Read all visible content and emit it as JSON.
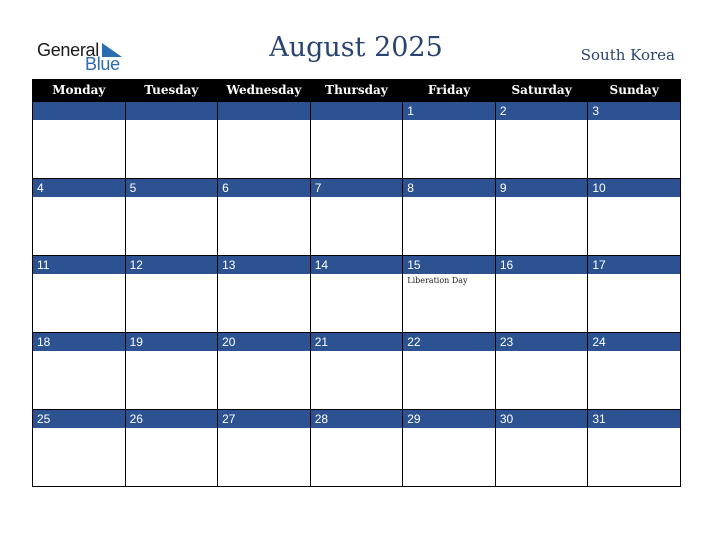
{
  "logo": {
    "word1": "General",
    "word2": "Blue"
  },
  "title": "August 2025",
  "country": "South Korea",
  "colors": {
    "header_bg": "#000000",
    "day_band": "#2c5292",
    "title": "#2a4470"
  },
  "weekdays": [
    "Monday",
    "Tuesday",
    "Wednesday",
    "Thursday",
    "Friday",
    "Saturday",
    "Sunday"
  ],
  "weeks": [
    [
      {
        "day": ""
      },
      {
        "day": ""
      },
      {
        "day": ""
      },
      {
        "day": ""
      },
      {
        "day": "1"
      },
      {
        "day": "2"
      },
      {
        "day": "3"
      }
    ],
    [
      {
        "day": "4"
      },
      {
        "day": "5"
      },
      {
        "day": "6"
      },
      {
        "day": "7"
      },
      {
        "day": "8"
      },
      {
        "day": "9"
      },
      {
        "day": "10"
      }
    ],
    [
      {
        "day": "11"
      },
      {
        "day": "12"
      },
      {
        "day": "13"
      },
      {
        "day": "14"
      },
      {
        "day": "15",
        "event": "Liberation Day"
      },
      {
        "day": "16"
      },
      {
        "day": "17"
      }
    ],
    [
      {
        "day": "18"
      },
      {
        "day": "19"
      },
      {
        "day": "20"
      },
      {
        "day": "21"
      },
      {
        "day": "22"
      },
      {
        "day": "23"
      },
      {
        "day": "24"
      }
    ],
    [
      {
        "day": "25"
      },
      {
        "day": "26"
      },
      {
        "day": "27"
      },
      {
        "day": "28"
      },
      {
        "day": "29"
      },
      {
        "day": "30"
      },
      {
        "day": "31"
      }
    ]
  ]
}
